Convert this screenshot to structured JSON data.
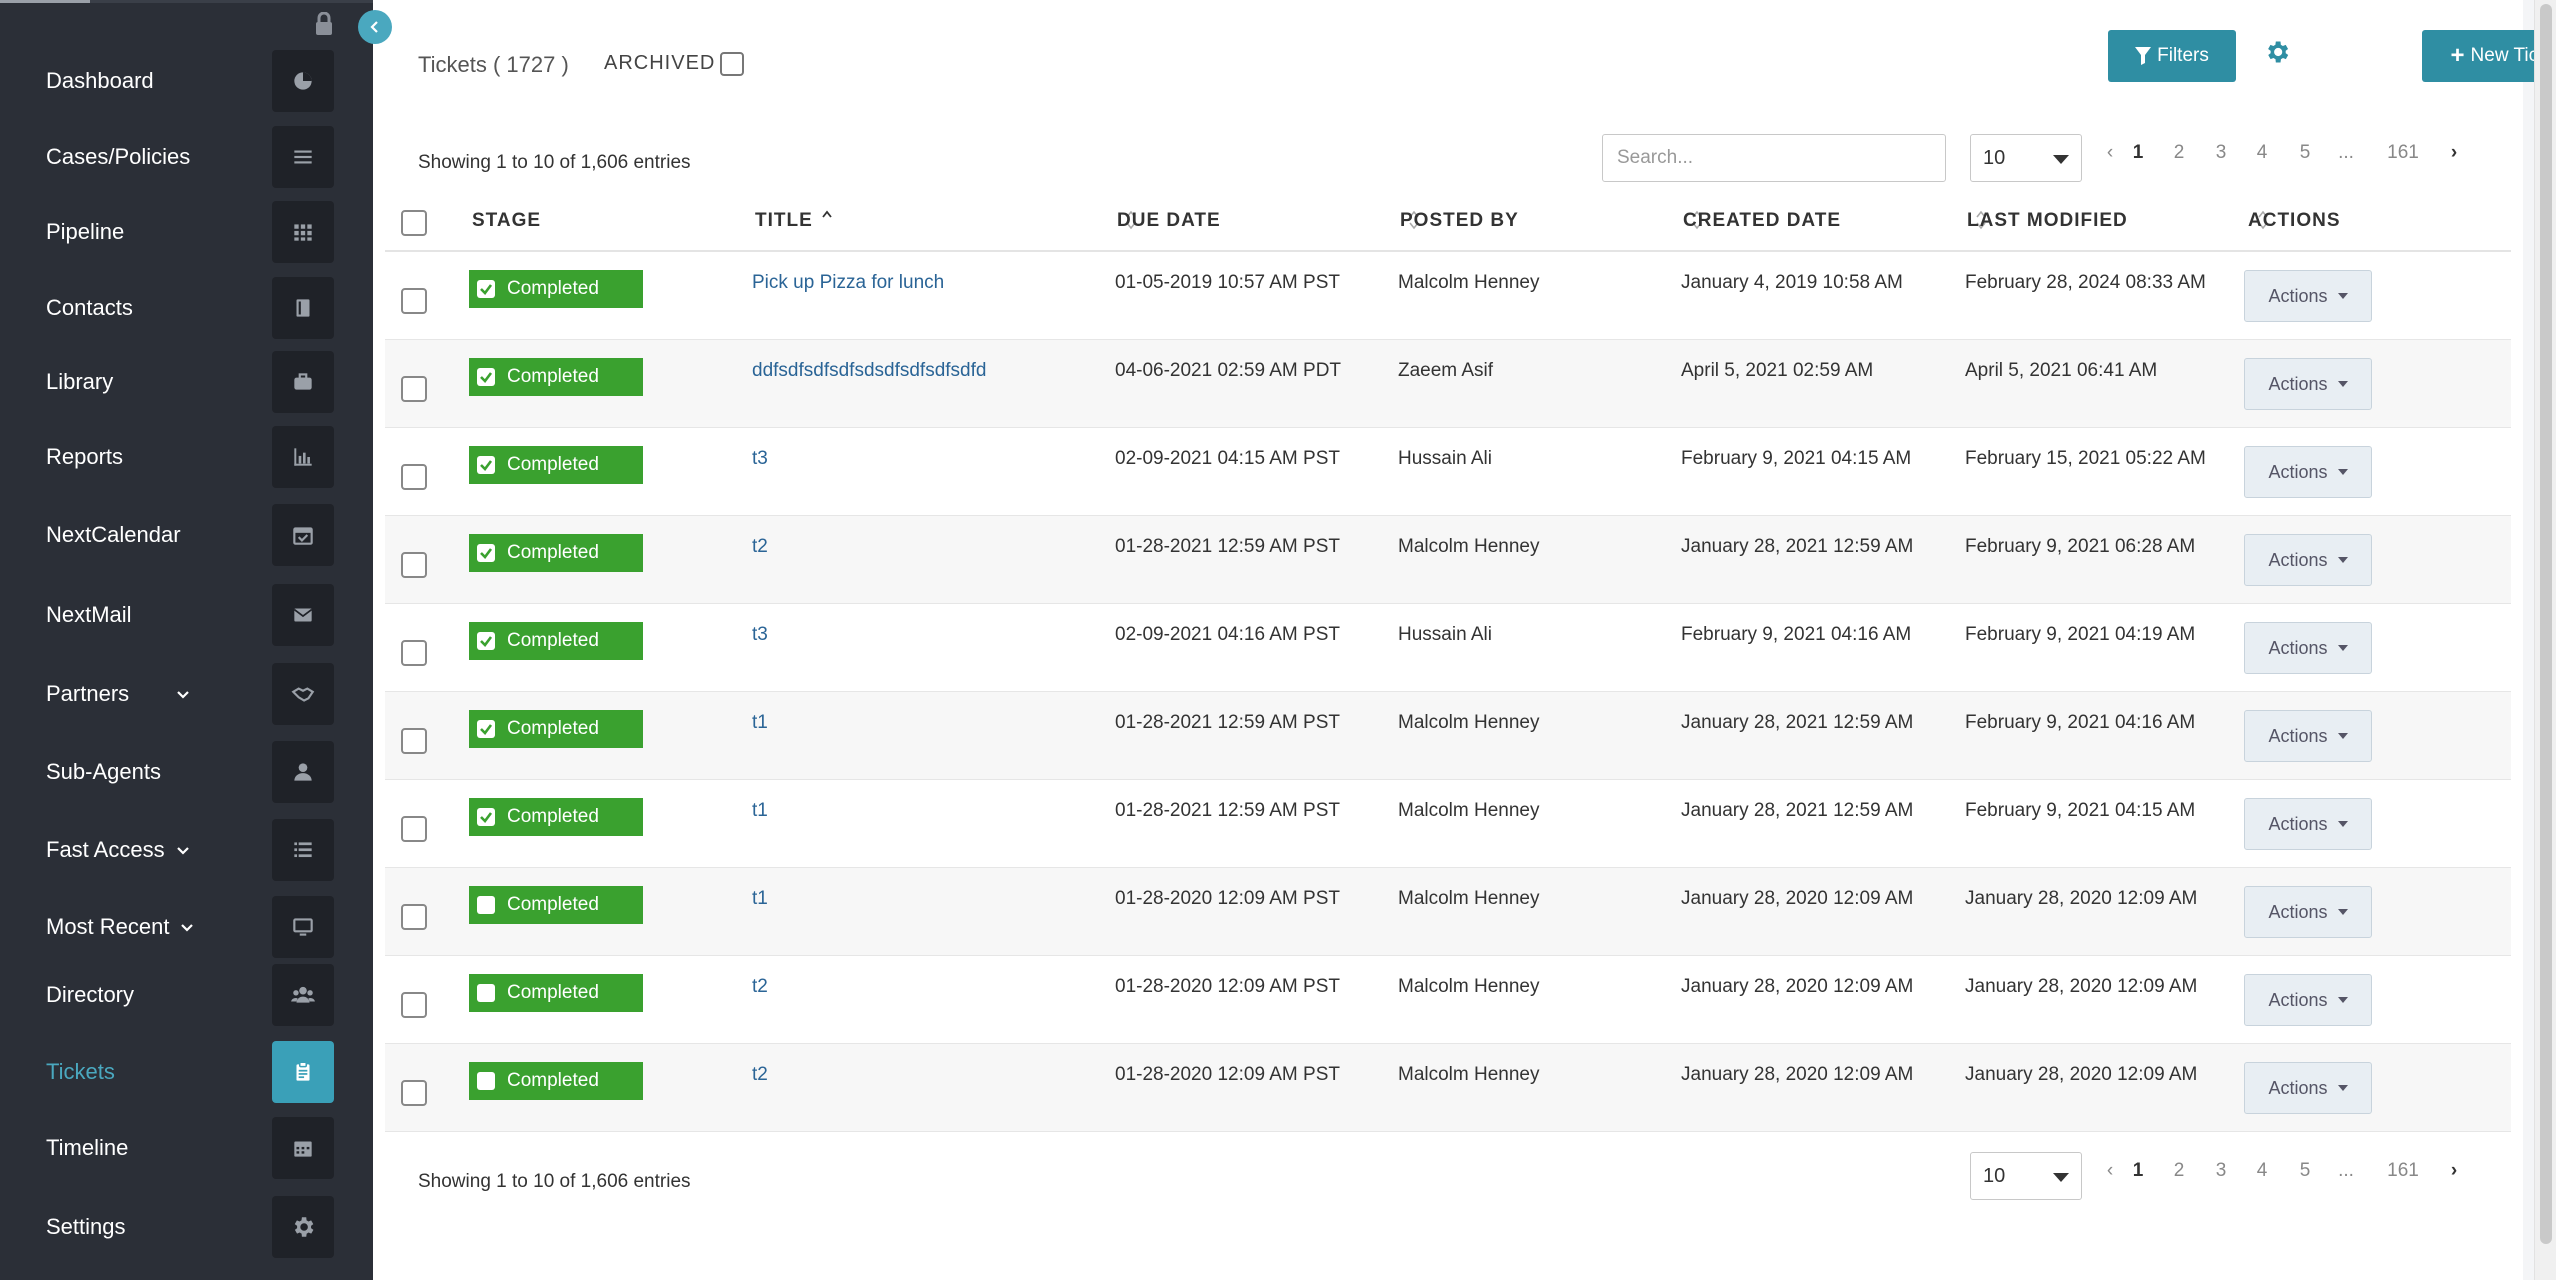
{
  "sidebar": {
    "items": [
      {
        "label": "Dashboard",
        "icon": "pie-chart-icon"
      },
      {
        "label": "Cases/Policies",
        "icon": "list-lines-icon"
      },
      {
        "label": "Pipeline",
        "icon": "grid-icon"
      },
      {
        "label": "Contacts",
        "icon": "address-book-icon"
      },
      {
        "label": "Library",
        "icon": "briefcase-icon"
      },
      {
        "label": "Reports",
        "icon": "bar-chart-icon"
      },
      {
        "label": "NextCalendar",
        "icon": "calendar-check-icon"
      },
      {
        "label": "NextMail",
        "icon": "envelope-icon"
      },
      {
        "label": "Partners",
        "icon": "handshake-icon"
      },
      {
        "label": "Sub-Agents",
        "icon": "user-icon"
      },
      {
        "label": "Fast Access",
        "icon": "list-bullets-icon"
      },
      {
        "label": "Most Recent",
        "icon": "monitor-icon"
      },
      {
        "label": "Directory",
        "icon": "users-icon"
      },
      {
        "label": "Tickets",
        "icon": "clipboard-icon"
      },
      {
        "label": "Timeline",
        "icon": "calendar-icon"
      },
      {
        "label": "Settings",
        "icon": "gear-icon"
      }
    ],
    "active": "Tickets",
    "accent": "#4aa8bf"
  },
  "header": {
    "title": "Tickets ( 1727 )",
    "archived_label": "ARCHIVED",
    "filters_label": "Filters",
    "new_ticket_label": "New Ticket"
  },
  "toolbar": {
    "showing_text": "Showing 1 to 10 of 1,606 entries",
    "search_placeholder": "Search...",
    "page_length": "10"
  },
  "pagination": {
    "pages": [
      "1",
      "2",
      "3",
      "4",
      "5",
      "...",
      "161"
    ],
    "current": "1"
  },
  "table": {
    "columns": [
      "STAGE",
      "TITLE",
      "DUE DATE",
      "POSTED BY",
      "CREATED DATE",
      "LAST MODIFIED",
      "ACTIONS"
    ],
    "stage_color": "#3aa12f",
    "action_label": "Actions",
    "rows": [
      {
        "stage": "Completed",
        "checked": true,
        "title": "Pick up Pizza for lunch",
        "due": "01-05-2019 10:57 AM PST",
        "posted_by": "Malcolm Henney",
        "created": "January 4, 2019 10:58 AM",
        "modified": "February 28, 2024 08:33 AM"
      },
      {
        "stage": "Completed",
        "checked": true,
        "title": "ddfsdfsdfsdfsdsdfsdfsdfsdfd",
        "due": "04-06-2021 02:59 AM PDT",
        "posted_by": "Zaeem Asif",
        "created": "April 5, 2021 02:59 AM",
        "modified": "April 5, 2021 06:41 AM"
      },
      {
        "stage": "Completed",
        "checked": true,
        "title": "t3",
        "due": "02-09-2021 04:15 AM PST",
        "posted_by": "Hussain Ali",
        "created": "February 9, 2021 04:15 AM",
        "modified": "February 15, 2021 05:22 AM"
      },
      {
        "stage": "Completed",
        "checked": true,
        "title": "t2",
        "due": "01-28-2021 12:59 AM PST",
        "posted_by": "Malcolm Henney",
        "created": "January 28, 2021 12:59 AM",
        "modified": "February 9, 2021 06:28 AM"
      },
      {
        "stage": "Completed",
        "checked": true,
        "title": "t3",
        "due": "02-09-2021 04:16 AM PST",
        "posted_by": "Hussain Ali",
        "created": "February 9, 2021 04:16 AM",
        "modified": "February 9, 2021 04:19 AM"
      },
      {
        "stage": "Completed",
        "checked": true,
        "title": "t1",
        "due": "01-28-2021 12:59 AM PST",
        "posted_by": "Malcolm Henney",
        "created": "January 28, 2021 12:59 AM",
        "modified": "February 9, 2021 04:16 AM"
      },
      {
        "stage": "Completed",
        "checked": true,
        "title": "t1",
        "due": "01-28-2021 12:59 AM PST",
        "posted_by": "Malcolm Henney",
        "created": "January 28, 2021 12:59 AM",
        "modified": "February 9, 2021 04:15 AM"
      },
      {
        "stage": "Completed",
        "checked": false,
        "title": "t1",
        "due": "01-28-2020 12:09 AM PST",
        "posted_by": "Malcolm Henney",
        "created": "January 28, 2020 12:09 AM",
        "modified": "January 28, 2020 12:09 AM"
      },
      {
        "stage": "Completed",
        "checked": false,
        "title": "t2",
        "due": "01-28-2020 12:09 AM PST",
        "posted_by": "Malcolm Henney",
        "created": "January 28, 2020 12:09 AM",
        "modified": "January 28, 2020 12:09 AM"
      },
      {
        "stage": "Completed",
        "checked": false,
        "title": "t2",
        "due": "01-28-2020 12:09 AM PST",
        "posted_by": "Malcolm Henney",
        "created": "January 28, 2020 12:09 AM",
        "modified": "January 28, 2020 12:09 AM"
      }
    ]
  }
}
